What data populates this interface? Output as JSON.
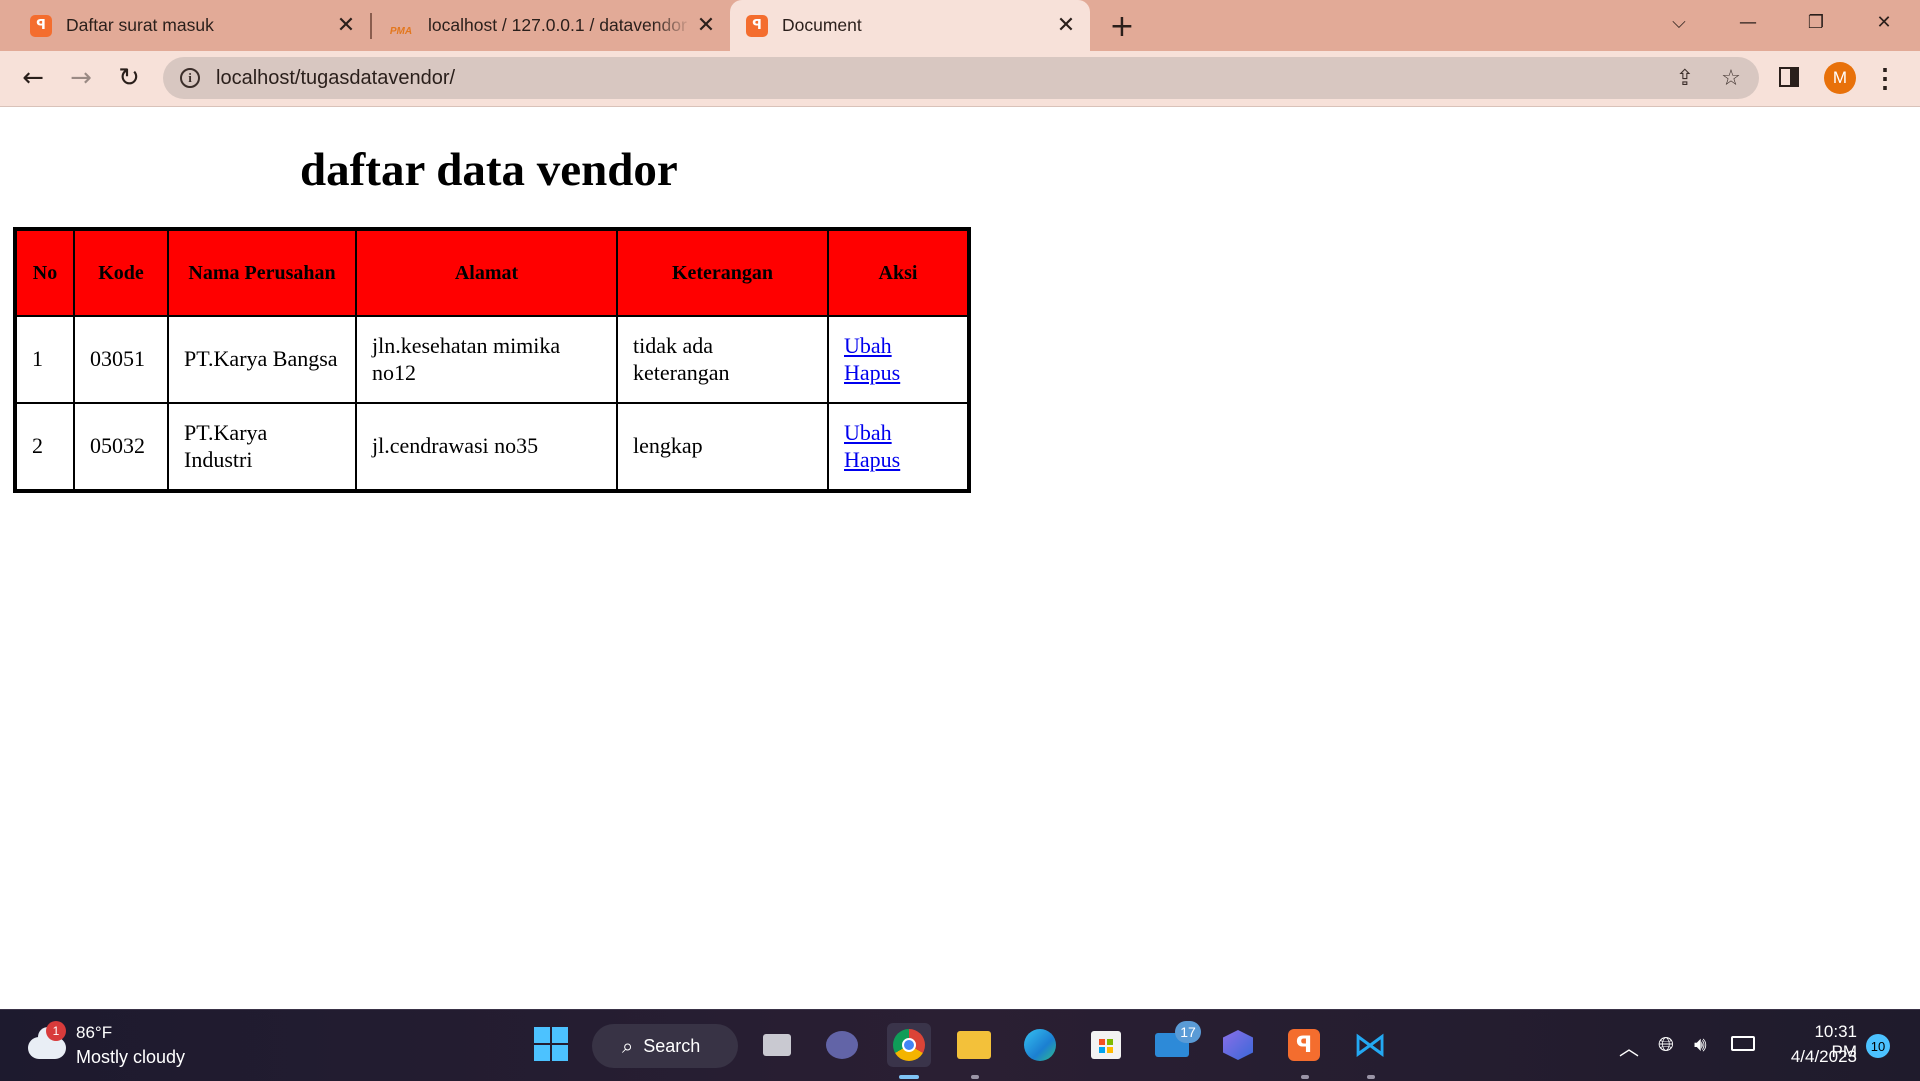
{
  "browser": {
    "tabs": [
      {
        "title": "Daftar surat masuk",
        "favicon": "xampp-icon",
        "active": false
      },
      {
        "title": "localhost / 127.0.0.1 / datavendor",
        "favicon": "phpmyadmin-icon",
        "favicon_text": "PMA",
        "active": false
      },
      {
        "title": "Document",
        "favicon": "xampp-icon",
        "active": true
      }
    ],
    "url": "localhost/tugasdatavendor/",
    "profile_initial": "M",
    "accent": "#e8710a",
    "tabstrip_color": "#e2aa97"
  },
  "page": {
    "heading": "daftar data vendor",
    "table": {
      "header_color": "#ff0000",
      "columns": [
        "No",
        "Kode",
        "Nama Perusahan",
        "Alamat",
        "Keterangan",
        "Aksi"
      ],
      "rows": [
        {
          "no": "1",
          "kode": "03051",
          "nama": "PT.Karya Bangsa",
          "alamat": "jln.kesehatan mimika no12",
          "keterangan": "tidak ada keterangan",
          "edit": "Ubah",
          "delete": "Hapus"
        },
        {
          "no": "2",
          "kode": "05032",
          "nama": "PT.Karya Industri",
          "alamat": "jl.cendrawasi no35",
          "keterangan": "lengkap",
          "edit": "Ubah",
          "delete": "Hapus"
        }
      ]
    }
  },
  "taskbar": {
    "weather_temp": "86°F",
    "weather_desc": "Mostly cloudy",
    "weather_badge": "1",
    "search_label": "Search",
    "mail_badge": "17",
    "time": "10:31 PM",
    "date": "4/4/2023",
    "notification_count": "10"
  }
}
